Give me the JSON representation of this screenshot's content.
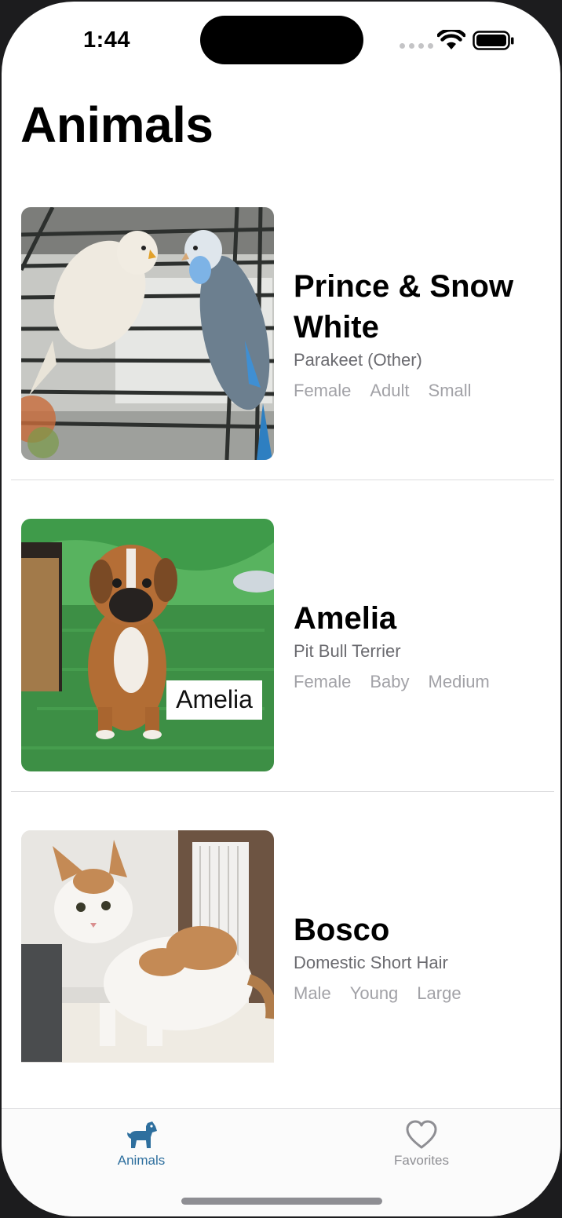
{
  "status_bar": {
    "time": "1:44"
  },
  "header": {
    "title": "Animals"
  },
  "animals": [
    {
      "name": "Prince & Snow White",
      "breed": "Parakeet (Other)",
      "gender": "Female",
      "age": "Adult",
      "size": "Small"
    },
    {
      "name": "Amelia",
      "breed": "Pit Bull Terrier",
      "gender": "Female",
      "age": "Baby",
      "size": "Medium",
      "photo_label": "Amelia"
    },
    {
      "name": "Bosco",
      "breed": "Domestic Short Hair",
      "gender": "Male",
      "age": "Young",
      "size": "Large"
    }
  ],
  "tab_bar": {
    "animals_label": "Animals",
    "favorites_label": "Favorites",
    "animals_icon": "dog-icon",
    "favorites_icon": "heart-icon",
    "active_color": "#2e6f9e",
    "inactive_color": "#8e8e93"
  }
}
